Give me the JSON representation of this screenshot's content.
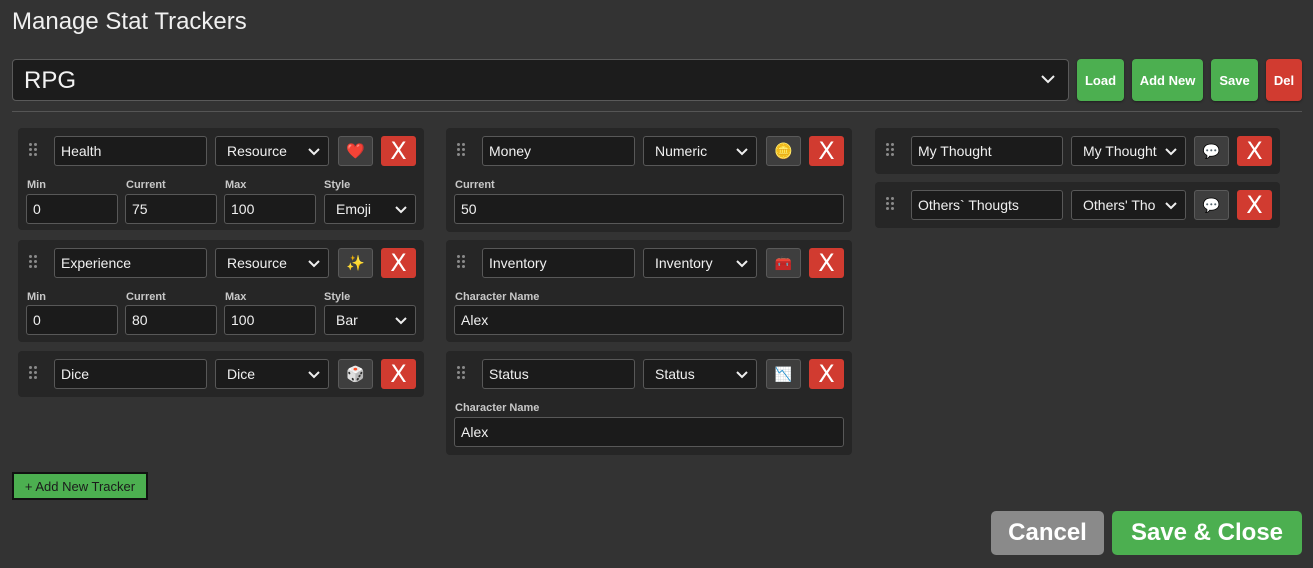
{
  "title": "Manage Stat Trackers",
  "preset": {
    "selected": "RPG"
  },
  "buttons": {
    "load": "Load",
    "add_new": "Add New",
    "save": "Save",
    "del": "Del"
  },
  "labels": {
    "min": "Min",
    "current": "Current",
    "max": "Max",
    "style": "Style",
    "character_name": "Character Name"
  },
  "trackers": {
    "health": {
      "name": "Health",
      "type": "Resource",
      "icon": "❤️",
      "min": "0",
      "current": "75",
      "max": "100",
      "style": "Emoji"
    },
    "experience": {
      "name": "Experience",
      "type": "Resource",
      "icon": "✨",
      "min": "0",
      "current": "80",
      "max": "100",
      "style": "Bar"
    },
    "dice": {
      "name": "Dice",
      "type": "Dice",
      "icon": "🎲"
    },
    "money": {
      "name": "Money",
      "type": "Numeric",
      "icon": "🪙",
      "current": "50"
    },
    "inventory": {
      "name": "Inventory",
      "type": "Inventory",
      "icon": "🧰",
      "character_name": "Alex"
    },
    "status": {
      "name": "Status",
      "type": "Status",
      "icon": "📉",
      "character_name": "Alex"
    },
    "my_thought": {
      "name": "My Thought",
      "type": "My Thought",
      "icon": "💬"
    },
    "others_thoughts": {
      "name": "Others` Thougts",
      "type": "Others' Tho",
      "icon": "💬"
    }
  },
  "delete_label": "X",
  "add_tracker_label": "+ Add New Tracker",
  "footer": {
    "cancel": "Cancel",
    "save_close": "Save & Close"
  }
}
